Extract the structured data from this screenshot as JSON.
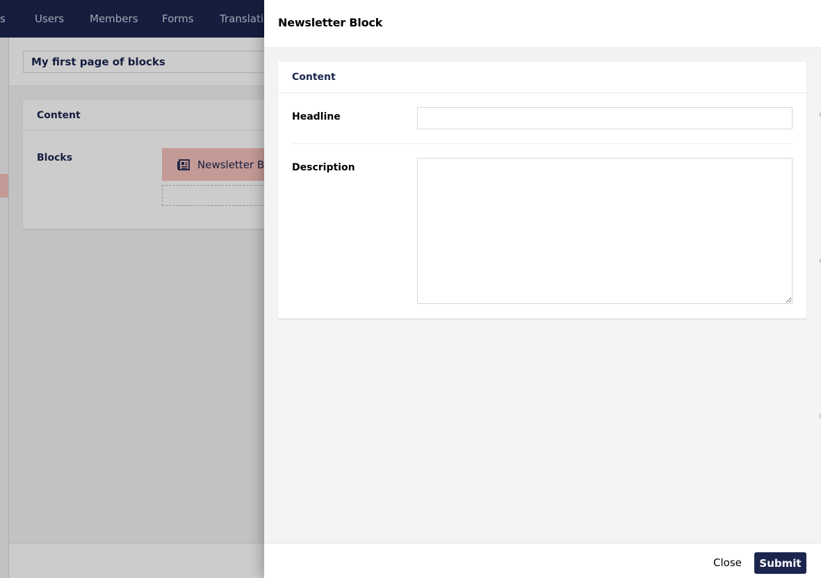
{
  "topnav": {
    "items": [
      {
        "label": "s"
      },
      {
        "label": "Users"
      },
      {
        "label": "Members"
      },
      {
        "label": "Forms"
      },
      {
        "label": "Translatio"
      }
    ]
  },
  "editor": {
    "name_value": "My first page of blocks",
    "group_label": "Content",
    "blocks_label": "Blocks",
    "block_item_label": "Newsletter Block",
    "block_icon": "newspaper-icon"
  },
  "modal": {
    "title": "Newsletter Block",
    "panel_title": "Content",
    "fields": {
      "headline": {
        "label": "Headline",
        "value": ""
      },
      "description": {
        "label": "Description",
        "value": ""
      }
    },
    "footer": {
      "close_label": "Close",
      "submit_label": "Submit"
    }
  },
  "colors": {
    "nav_bg": "#1b264f",
    "accent": "#1b264f",
    "block_bg": "#f5c1bc",
    "modal_bg": "#f4f3f4"
  }
}
